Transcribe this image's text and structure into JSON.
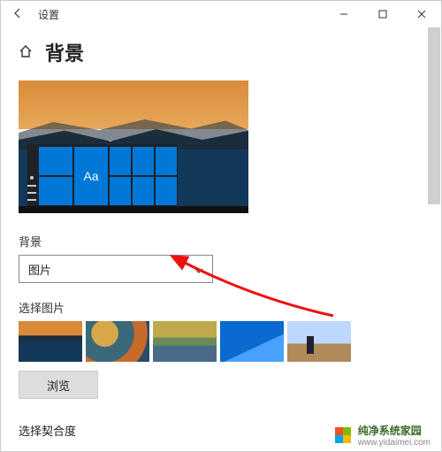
{
  "window": {
    "app_title": "设置"
  },
  "page": {
    "title": "背景"
  },
  "preview": {
    "sample_text": "Aa"
  },
  "background_section": {
    "label": "背景",
    "dropdown_value": "图片"
  },
  "choose_picture": {
    "label": "选择图片",
    "browse_label": "浏览",
    "thumbs": [
      "sunset-mountains",
      "abstract-aerial",
      "yellowstone",
      "windows-blue",
      "beach"
    ]
  },
  "fit_section": {
    "label": "选择契合度"
  },
  "watermark": {
    "brand": "纯净系统家园",
    "url": "www.yidaimei.com"
  }
}
